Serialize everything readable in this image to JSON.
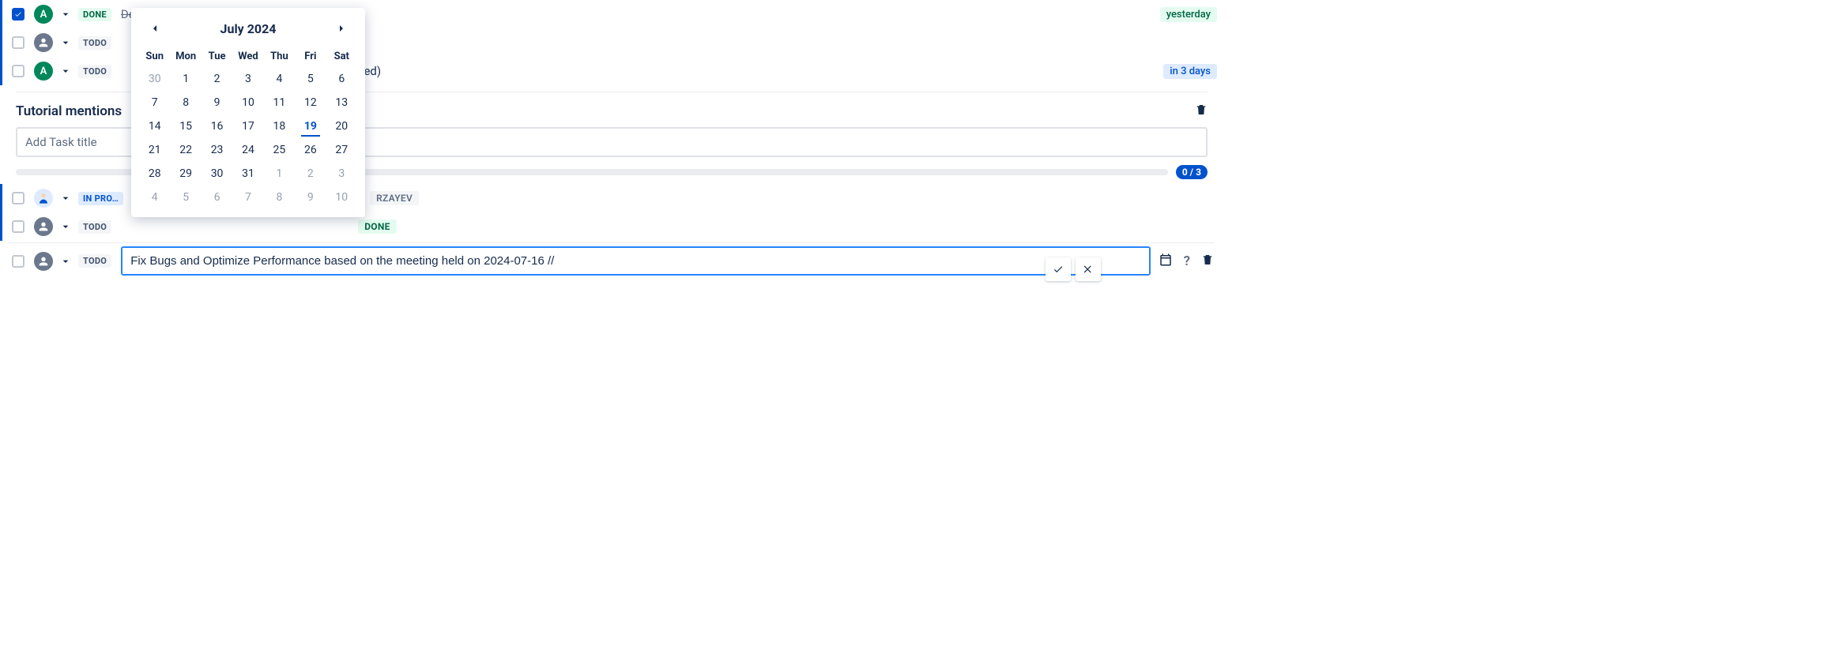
{
  "tasks": [
    {
      "status": "DONE",
      "avatar_type": "green",
      "avatar_letter": "A",
      "title": "Develop User Authentication",
      "strike": true,
      "checked": true,
      "date_label": "yesterday",
      "date_class": "date-yesterday"
    },
    {
      "status": "TODO",
      "avatar_type": "gray",
      "title": "",
      "date_label": ""
    },
    {
      "status": "TODO",
      "avatar_type": "green",
      "avatar_letter": "A",
      "title_suffix": "lied)",
      "date_label": "in 3 days",
      "date_class": "date-future"
    }
  ],
  "section": {
    "title": "Tutorial mentions"
  },
  "add_task": {
    "placeholder": "Add Task title"
  },
  "progress": {
    "label": "0 / 3"
  },
  "mention_tasks": [
    {
      "status": "IN PRO…",
      "status_class": "status-inprog",
      "avatar_type": "img",
      "extra_badge": "RZAYEV",
      "extra_badge_class": "mention-badge"
    },
    {
      "status": "TODO",
      "status_class": "status-todo",
      "avatar_type": "gray",
      "extra_badge": "DONE",
      "extra_badge_class": "mention-done"
    }
  ],
  "edit_row": {
    "status": "TODO",
    "value": "Fix Bugs and Optimize Performance based on the meeting held on 2024-07-16 //"
  },
  "calendar": {
    "title": "July 2024",
    "dow": [
      "Sun",
      "Mon",
      "Tue",
      "Wed",
      "Thu",
      "Fri",
      "Sat"
    ],
    "days": [
      {
        "d": "30",
        "out": true
      },
      {
        "d": "1"
      },
      {
        "d": "2"
      },
      {
        "d": "3"
      },
      {
        "d": "4"
      },
      {
        "d": "5"
      },
      {
        "d": "6"
      },
      {
        "d": "7"
      },
      {
        "d": "8"
      },
      {
        "d": "9"
      },
      {
        "d": "10"
      },
      {
        "d": "11"
      },
      {
        "d": "12"
      },
      {
        "d": "13"
      },
      {
        "d": "14"
      },
      {
        "d": "15"
      },
      {
        "d": "16"
      },
      {
        "d": "17"
      },
      {
        "d": "18"
      },
      {
        "d": "19",
        "sel": true
      },
      {
        "d": "20"
      },
      {
        "d": "21"
      },
      {
        "d": "22"
      },
      {
        "d": "23"
      },
      {
        "d": "24"
      },
      {
        "d": "25"
      },
      {
        "d": "26"
      },
      {
        "d": "27"
      },
      {
        "d": "28"
      },
      {
        "d": "29"
      },
      {
        "d": "30"
      },
      {
        "d": "31"
      },
      {
        "d": "1",
        "out": true
      },
      {
        "d": "2",
        "out": true
      },
      {
        "d": "3",
        "out": true
      },
      {
        "d": "4",
        "out": true
      },
      {
        "d": "5",
        "out": true
      },
      {
        "d": "6",
        "out": true
      },
      {
        "d": "7",
        "out": true
      },
      {
        "d": "8",
        "out": true
      },
      {
        "d": "9",
        "out": true
      },
      {
        "d": "10",
        "out": true
      }
    ]
  }
}
